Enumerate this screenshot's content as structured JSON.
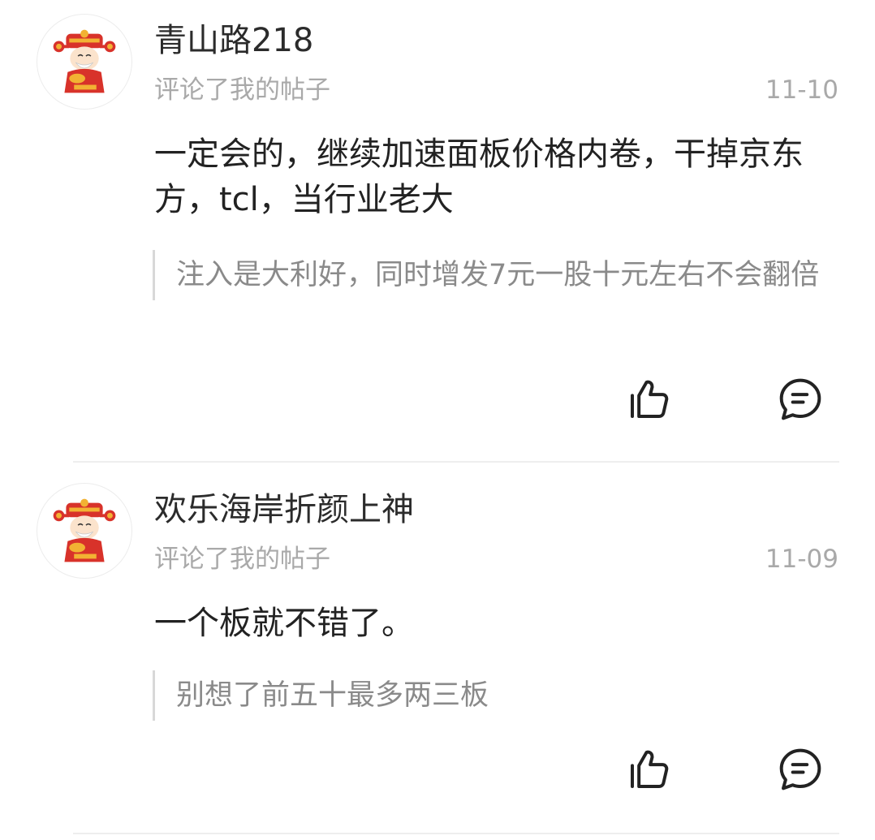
{
  "comments": [
    {
      "username": "青山路218",
      "subtitle": "评论了我的帖子",
      "date": "11-10",
      "text": "一定会的，继续加速面板价格内卷，干掉京东方，tcl，当行业老大",
      "quote": "注入是大利好，同时增发7元一股十元左右不会翻倍",
      "avatar_icon": "caishen-avatar-icon",
      "like_icon": "thumbs-up-icon",
      "reply_icon": "comment-bubble-icon"
    },
    {
      "username": "欢乐海岸折颜上神",
      "subtitle": "评论了我的帖子",
      "date": "11-09",
      "text": "一个板就不错了。",
      "quote": "别想了前五十最多两三板",
      "avatar_icon": "caishen-avatar-icon",
      "like_icon": "thumbs-up-icon",
      "reply_icon": "comment-bubble-icon"
    }
  ],
  "colors": {
    "text": "#222222",
    "muted": "#a9a9a9",
    "quote": "#8a8a8a",
    "divider": "#eeeeee",
    "avatar_red": "#d8322a",
    "avatar_gold": "#f2b233"
  }
}
